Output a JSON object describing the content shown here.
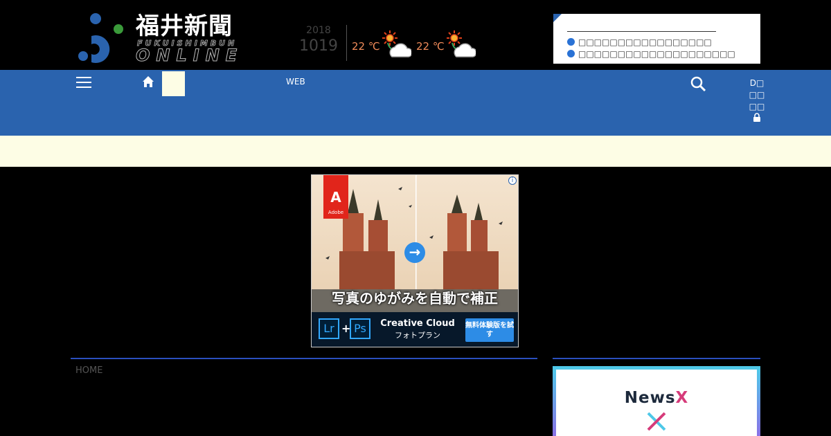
{
  "header": {
    "logo": {
      "title": "福井新聞",
      "subtitle": "FUKUISHIMBUN",
      "online": "ONLINE"
    },
    "date": {
      "year": "2018",
      "month_day": "1019"
    },
    "weather": [
      {
        "temp": "22 ℃",
        "icon": "sunny-cloudy-icon"
      },
      {
        "temp": "22 ℃",
        "icon": "sunny-cloudy-icon"
      }
    ],
    "notices": [
      "□□□□□□□□□□□□□□□□□",
      "□□□□□□□□□□□□□□□□□□□□"
    ]
  },
  "nav": {
    "web_label": "WEB",
    "login_lines": [
      "D□",
      "□□",
      "□□"
    ]
  },
  "ad": {
    "brand": "Adobe",
    "headline": "写真のゆがみを自動で補正",
    "product_1": "Lr",
    "product_2": "Ps",
    "plus": "+",
    "cc_line1": "Creative Cloud",
    "cc_line2": "フォトプラン",
    "button_text": "無料体験版を試す",
    "info_mark": "i"
  },
  "content": {
    "breadcrumb": "HOME"
  },
  "sidebar": {
    "card_title_news": "News",
    "card_title_x": "X"
  },
  "colors": {
    "nav_blue": "#2a63ae",
    "cream": "#fdfde5",
    "rule_blue": "#2a4fbe",
    "weather_orange": "#f28c5a"
  }
}
